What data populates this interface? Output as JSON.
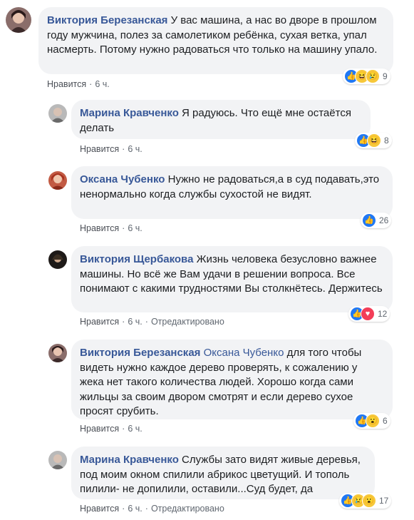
{
  "comments": [
    {
      "author": "Виктория Березанская",
      "mention": "",
      "text": "У вас машина, а нас во дворе в прошлом году мужчина, полез за самолетиком ребёнка, сухая ветка, упал насмерть. Потому нужно радоваться что только на машину упало.",
      "like": "Нравится",
      "time": "6 ч.",
      "edited": "",
      "reactions": [
        "like-icon",
        "haha-icon",
        "sad-icon"
      ],
      "count": "9"
    },
    {
      "author": "Марина Кравченко",
      "mention": "",
      "text": "Я радуюсь. Что ещё мне остаётся делать",
      "like": "Нравится",
      "time": "6 ч.",
      "edited": "",
      "reactions": [
        "like-icon",
        "haha-icon"
      ],
      "count": "8"
    },
    {
      "author": "Оксана Чубенко",
      "mention": "",
      "text": "Нужно не радоваться,а в суд подавать,это ненормально когда службы сухостой не видят.",
      "like": "Нравится",
      "time": "6 ч.",
      "edited": "",
      "reactions": [
        "like-icon"
      ],
      "count": "26"
    },
    {
      "author": "Виктория Щербакова",
      "mention": "",
      "text": "Жизнь человека безусловно важнее машины. Но всё же Вам удачи в решении вопроса. Все понимают с какими трудностями Вы столкнётесь. Держитесь",
      "like": "Нравится",
      "time": "6 ч.",
      "edited": "Отредактировано",
      "reactions": [
        "like-icon",
        "love-icon"
      ],
      "count": "12"
    },
    {
      "author": "Виктория Березанская",
      "mention": "Оксана Чубенко",
      "text": "для того чтобы видеть нужно каждое дерево проверять, к сожалению у жека нет такого количества людей. Хорошо когда сами жильцы за своим двором смотрят и если дерево сухое просят срубить.",
      "like": "Нравится",
      "time": "6 ч.",
      "edited": "",
      "reactions": [
        "like-icon",
        "wow-icon"
      ],
      "count": "6"
    },
    {
      "author": "Марина Кравченко",
      "mention": "",
      "text": "Службы зато видят живые деревья, под моим окном спилили абрикос цветущий. И тополь пилили- не допилили, оставили...Суд будет, да",
      "like": "Нравится",
      "time": "6 ч.",
      "edited": "Отредактировано",
      "reactions": [
        "like-icon",
        "sad-icon",
        "wow-icon"
      ],
      "count": "17"
    }
  ],
  "colors": {
    "author": "#385898",
    "bubble": "#f2f3f5",
    "meta": "#606770",
    "like_reaction": "#2078f4",
    "love_reaction": "#f33e58",
    "emoji_reaction": "#f7c83a"
  }
}
